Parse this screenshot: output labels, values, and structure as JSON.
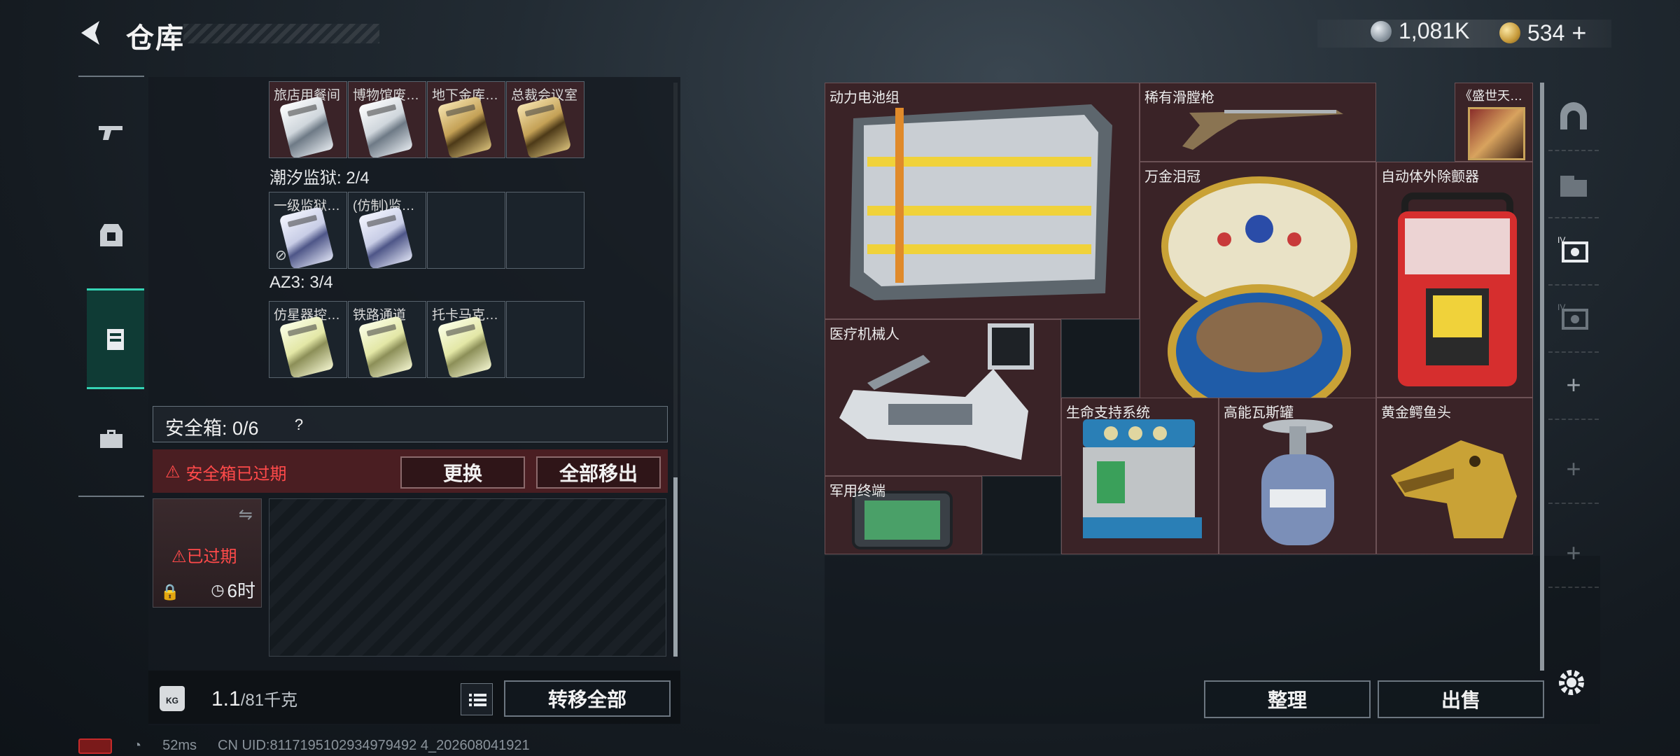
{
  "header": {
    "title": "仓库",
    "silver_amount": "1,081K",
    "gold_amount": "534",
    "gold_plus": "+"
  },
  "nav": {
    "items": [
      {
        "name": "weapons",
        "icon": "gun-icon"
      },
      {
        "name": "gear",
        "icon": "armor-icon"
      },
      {
        "name": "collectibles",
        "icon": "keycard-holder-icon",
        "active": true
      },
      {
        "name": "toolbox",
        "icon": "toolbox-icon"
      }
    ]
  },
  "keycards": {
    "groups": [
      {
        "label": "",
        "slots": [
          {
            "name": "旅店用餐间",
            "color": "silver"
          },
          {
            "name": "博物馆废…",
            "color": "silver"
          },
          {
            "name": "地下金库…",
            "color": "gold"
          },
          {
            "name": "总裁会议室",
            "color": "gold"
          }
        ]
      },
      {
        "label": "潮汐监狱: 2/4",
        "slots": [
          {
            "name": "一级监狱…",
            "color": "blue",
            "flag": "no-entry-icon"
          },
          {
            "name": "(仿制)监…",
            "color": "blue"
          },
          {
            "name": ""
          },
          {
            "name": ""
          }
        ]
      },
      {
        "label": "AZ3: 3/4",
        "slots": [
          {
            "name": "仿星器控…",
            "color": "yellow"
          },
          {
            "name": "铁路通道",
            "color": "yellow"
          },
          {
            "name": "托卡马克…",
            "color": "yellow"
          },
          {
            "name": ""
          }
        ]
      }
    ]
  },
  "safe_box": {
    "label": "安全箱: 0/6",
    "help": "?",
    "expired_message": "安全箱已过期",
    "replace_button": "更换",
    "move_all_button": "全部移出",
    "thumb_status": "已过期",
    "thumb_timer": "6时"
  },
  "weight": {
    "current": "1.1",
    "capacity": "/81千克",
    "transfer_all_button": "转移全部",
    "kg_label": "KG"
  },
  "status": {
    "ping": "52ms",
    "uid": "CN UID:8117195102934979492 4_202608041921"
  },
  "grid_items": [
    {
      "name": "动力电池组",
      "kind": "battery"
    },
    {
      "name": "稀有滑膛枪",
      "kind": "musket"
    },
    {
      "name": "《盛世天…",
      "kind": "painting"
    },
    {
      "name": "万金泪冠",
      "kind": "egg"
    },
    {
      "name": "自动体外除颤器",
      "kind": "aed"
    },
    {
      "name": "医疗机械人",
      "kind": "robot"
    },
    {
      "name": "生命支持系统",
      "kind": "lifesupport"
    },
    {
      "name": "高能瓦斯罐",
      "kind": "gas"
    },
    {
      "name": "黄金鳄鱼头",
      "kind": "croc"
    },
    {
      "name": "军用终端",
      "kind": "terminal"
    }
  ],
  "actions": {
    "sort_button": "整理",
    "sell_button": "出售"
  },
  "colors": {
    "accent": "#35d3b4",
    "danger": "#ff4a4a",
    "item_bg": "#3a2327"
  }
}
